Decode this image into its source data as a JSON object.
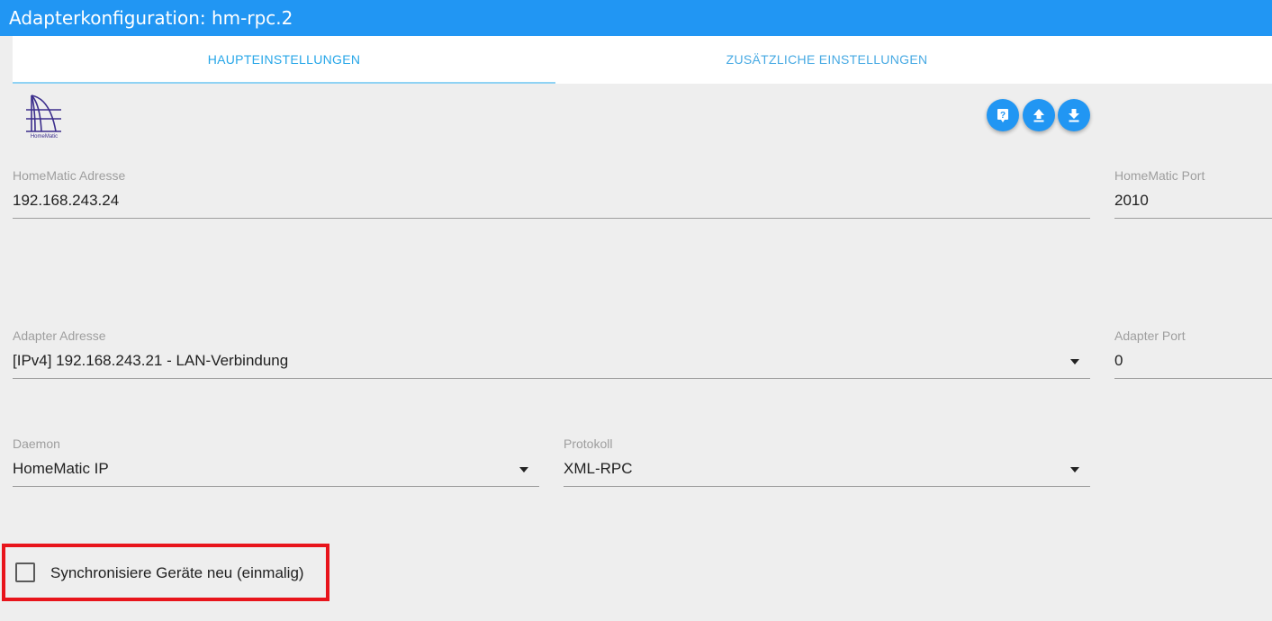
{
  "window": {
    "title": "Adapterkonfiguration: hm-rpc.2"
  },
  "tabs": [
    {
      "label": "HAUPTEINSTELLUNGEN",
      "active": true
    },
    {
      "label": "ZUSÄTZLICHE EINSTELLUNGEN",
      "active": false
    }
  ],
  "logo": {
    "text": "HomeMatic",
    "icon": "homematic-logo"
  },
  "toolbar": {
    "help_icon": "help-icon",
    "upload_icon": "upload-icon",
    "download_icon": "download-icon"
  },
  "fields": {
    "homematic_address": {
      "label": "HomeMatic Adresse",
      "value": "192.168.243.24"
    },
    "homematic_port": {
      "label": "HomeMatic Port",
      "value": "2010"
    },
    "adapter_address": {
      "label": "Adapter Adresse",
      "value": "[IPv4] 192.168.243.21 - LAN-Verbindung"
    },
    "adapter_port": {
      "label": "Adapter Port",
      "value": "0"
    },
    "daemon": {
      "label": "Daemon",
      "value": "HomeMatic IP"
    },
    "protocol": {
      "label": "Protokoll",
      "value": "XML-RPC"
    }
  },
  "sync": {
    "label": "Synchronisiere Geräte neu (einmalig)",
    "checked": false
  },
  "colors": {
    "accent": "#2196f3",
    "tab_active": "#26a6e8",
    "highlight": "#e8141b",
    "background": "#eeeeee"
  }
}
